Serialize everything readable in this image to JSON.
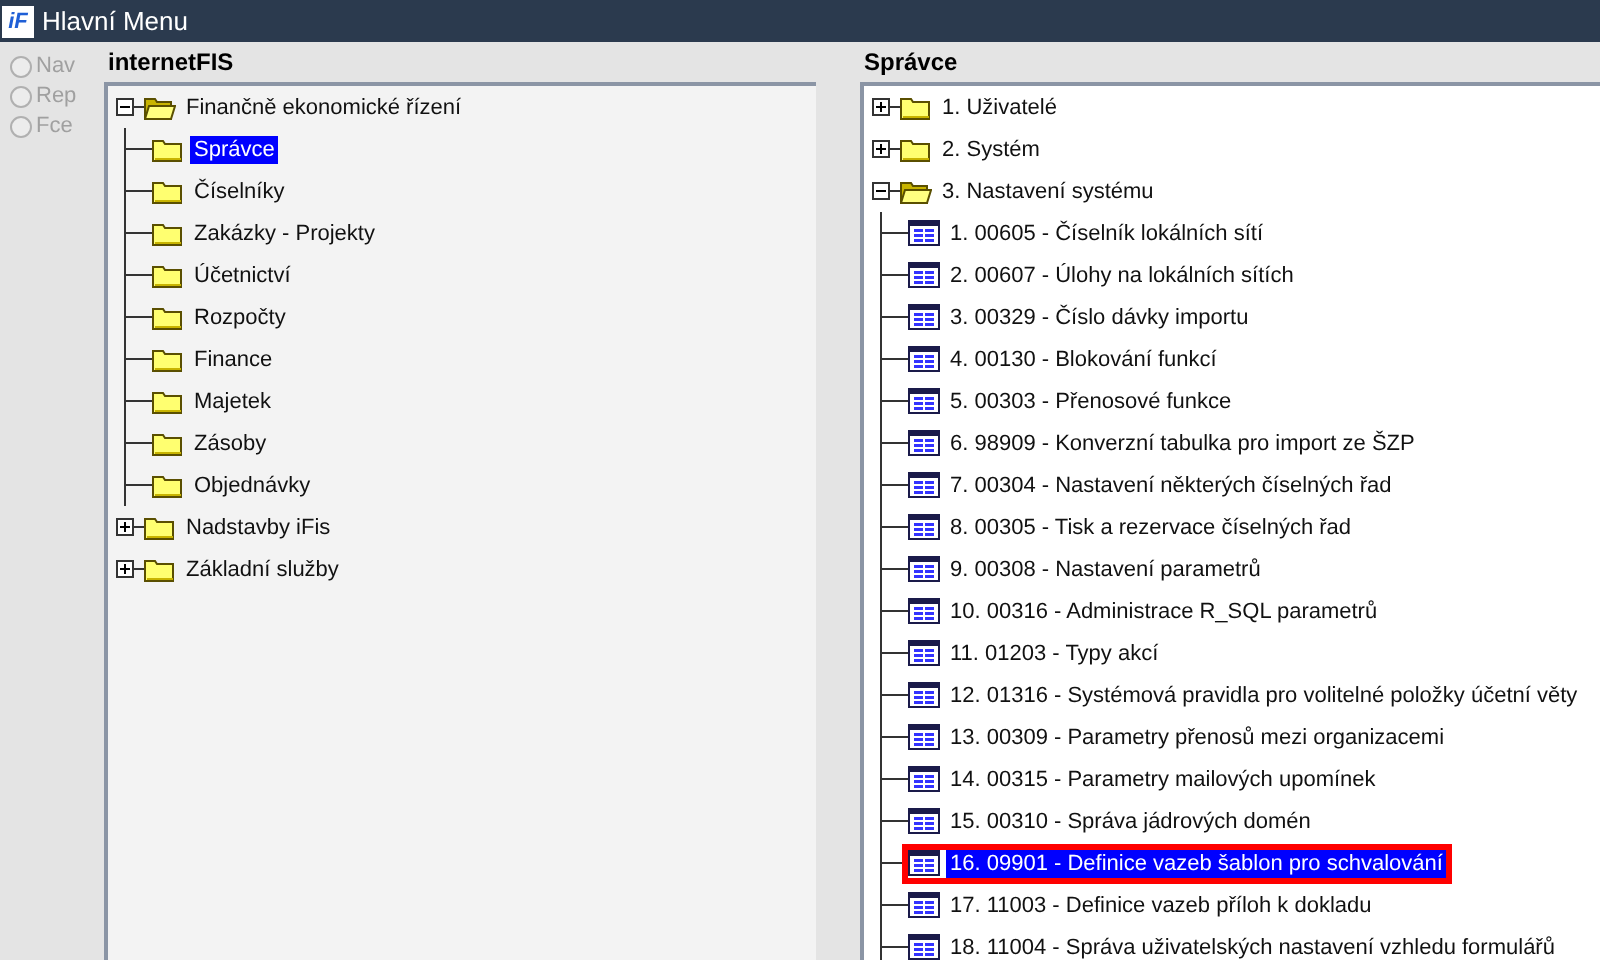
{
  "window": {
    "logo": "iF",
    "title": "Hlavní Menu"
  },
  "view_options": [
    {
      "label": "Nav",
      "selected": false,
      "disabled": true
    },
    {
      "label": "Rep",
      "selected": false,
      "disabled": true
    },
    {
      "label": "Fce",
      "selected": false,
      "disabled": true
    }
  ],
  "left_panel": {
    "title": "internetFIS",
    "tree": [
      {
        "label": "Finančně ekonomické řízení",
        "kind": "folder",
        "expanded": true,
        "selected": false,
        "children": [
          {
            "label": "Správce",
            "kind": "folder",
            "selected": true
          },
          {
            "label": "Číselníky",
            "kind": "folder",
            "selected": false
          },
          {
            "label": "Zakázky - Projekty",
            "kind": "folder",
            "selected": false
          },
          {
            "label": "Účetnictví",
            "kind": "folder",
            "selected": false
          },
          {
            "label": "Rozpočty",
            "kind": "folder",
            "selected": false
          },
          {
            "label": "Finance",
            "kind": "folder",
            "selected": false
          },
          {
            "label": "Majetek",
            "kind": "folder",
            "selected": false
          },
          {
            "label": "Zásoby",
            "kind": "folder",
            "selected": false
          },
          {
            "label": "Objednávky",
            "kind": "folder",
            "selected": false
          }
        ]
      },
      {
        "label": "Nadstavby iFis",
        "kind": "folder",
        "expanded": false,
        "selected": false
      },
      {
        "label": "Základní služby",
        "kind": "folder",
        "expanded": false,
        "selected": false
      }
    ]
  },
  "right_panel": {
    "title": "Správce",
    "tree": [
      {
        "label": "1. Uživatelé",
        "kind": "folder",
        "expanded": false,
        "selected": false
      },
      {
        "label": "2. Systém",
        "kind": "folder",
        "expanded": false,
        "selected": false
      },
      {
        "label": "3. Nastavení systému",
        "kind": "folder",
        "expanded": true,
        "selected": false,
        "children": [
          {
            "label": "1. 00605 - Číselník lokálních sítí",
            "kind": "form",
            "selected": false
          },
          {
            "label": "2. 00607 - Úlohy na lokálních sítích",
            "kind": "form",
            "selected": false
          },
          {
            "label": "3. 00329 - Číslo dávky importu",
            "kind": "form",
            "selected": false
          },
          {
            "label": "4. 00130 - Blokování funkcí",
            "kind": "form",
            "selected": false
          },
          {
            "label": "5. 00303 - Přenosové funkce",
            "kind": "form",
            "selected": false
          },
          {
            "label": "6. 98909 - Konverzní tabulka pro import ze ŠZP",
            "kind": "form",
            "selected": false
          },
          {
            "label": "7. 00304 - Nastavení některých číselných řad",
            "kind": "form",
            "selected": false
          },
          {
            "label": "8. 00305 - Tisk a rezervace číselných řad",
            "kind": "form",
            "selected": false
          },
          {
            "label": "9. 00308 - Nastavení parametrů",
            "kind": "form",
            "selected": false
          },
          {
            "label": "10. 00316 - Administrace R_SQL parametrů",
            "kind": "form",
            "selected": false
          },
          {
            "label": "11. 01203 - Typy akcí",
            "kind": "form",
            "selected": false
          },
          {
            "label": "12. 01316 - Systémová pravidla pro volitelné položky účetní věty",
            "kind": "form",
            "selected": false
          },
          {
            "label": "13. 00309 - Parametry přenosů mezi organizacemi",
            "kind": "form",
            "selected": false
          },
          {
            "label": "14. 00315 - Parametry mailových upomínek",
            "kind": "form",
            "selected": false
          },
          {
            "label": "15. 00310 - Správa jádrových domén",
            "kind": "form",
            "selected": false
          },
          {
            "label": "16. 09901 - Definice vazeb šablon pro schvalování",
            "kind": "form",
            "selected": true,
            "outlined": true
          },
          {
            "label": "17. 11003 - Definice vazeb příloh k dokladu",
            "kind": "form",
            "selected": false
          },
          {
            "label": "18. 11004 - Správa uživatelských nastavení vzhledu formulářů",
            "kind": "form",
            "selected": false
          }
        ]
      }
    ]
  }
}
